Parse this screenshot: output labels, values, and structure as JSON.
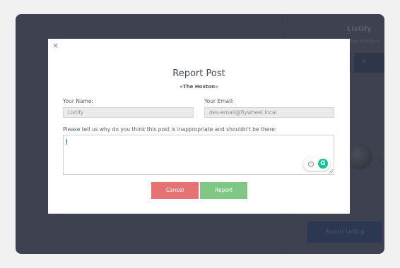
{
  "background": {
    "listing_title": "Listify",
    "listing_subtitle": "The Hoxton",
    "button_label": "P",
    "report_listing_label": "Report Listing"
  },
  "modal": {
    "close_label": "×",
    "title": "Report Post",
    "subtitle": "«The Hoxton»",
    "name_label": "Your Name:",
    "name_value": "Listify",
    "email_label": "Your Email:",
    "email_value": "dev-email@flywheel.local",
    "reason_label": "Please tell us why do you think this post is inappropriate and shouldn't be there:",
    "reason_value": "",
    "grammar_icon": "G",
    "cancel_label": "Cancel",
    "report_label": "Report"
  },
  "colors": {
    "overlay": "#3d4150",
    "cancel_button": "#e57373",
    "report_button": "#81c784",
    "grammarly": "#15c39a"
  }
}
